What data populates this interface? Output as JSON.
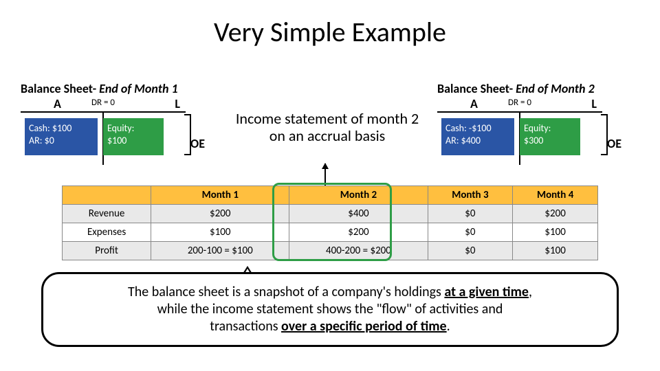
{
  "title": "Very Simple Example",
  "bs_left": {
    "heading_prefix": "Balance Sheet- ",
    "heading_italic": "End of Month 1",
    "a": "A",
    "l": "L",
    "oe": "OE",
    "dr": "DR = 0",
    "cash": "Cash: $100",
    "ar": "AR: $0",
    "equity_label": "Equity:",
    "equity_val": "$100"
  },
  "bs_right": {
    "heading_prefix": "Balance Sheet- ",
    "heading_italic": "End of Month 2",
    "a": "A",
    "l": "L",
    "oe": "OE",
    "dr": "DR = 0",
    "cash": "Cash: -$100",
    "ar": "AR: $400",
    "equity_label": "Equity:",
    "equity_val": "$300"
  },
  "center_statement_line1": "Income statement of month 2",
  "center_statement_line2": "on an accrual basis",
  "table": {
    "cols": [
      "Month 1",
      "Month 2",
      "Month 3",
      "Month 4"
    ],
    "rows": [
      {
        "label": "Revenue",
        "cells": [
          "$200",
          "$400",
          "$0",
          "$200"
        ]
      },
      {
        "label": "Expenses",
        "cells": [
          "$100",
          "$200",
          "$0",
          "$100"
        ]
      },
      {
        "label": "Profit",
        "cells": [
          "200-100 = $100",
          "400-200 = $200",
          "$0",
          "$100"
        ]
      }
    ]
  },
  "callout": {
    "p1a": "The balance sheet is a snapshot of a company's holdings ",
    "p1b": "at a given time",
    "p1c": ",",
    "p2a": "while the income statement shows the \"flow\" of activities and",
    "p3a": "transactions ",
    "p3b": "over a specific period of time",
    "p3c": "."
  },
  "chart_data": {
    "type": "table",
    "title": "Very Simple Example — monthly income statement (accrual basis)",
    "categories": [
      "Month 1",
      "Month 2",
      "Month 3",
      "Month 4"
    ],
    "series": [
      {
        "name": "Revenue",
        "values": [
          200,
          400,
          0,
          200
        ]
      },
      {
        "name": "Expenses",
        "values": [
          100,
          200,
          0,
          100
        ]
      },
      {
        "name": "Profit",
        "values": [
          100,
          200,
          0,
          100
        ]
      }
    ],
    "balance_sheets": [
      {
        "as_of": "End of Month 1",
        "cash": 100,
        "ar": 0,
        "equity": 100,
        "dr": 0
      },
      {
        "as_of": "End of Month 2",
        "cash": -100,
        "ar": 400,
        "equity": 300,
        "dr": 0
      }
    ]
  }
}
